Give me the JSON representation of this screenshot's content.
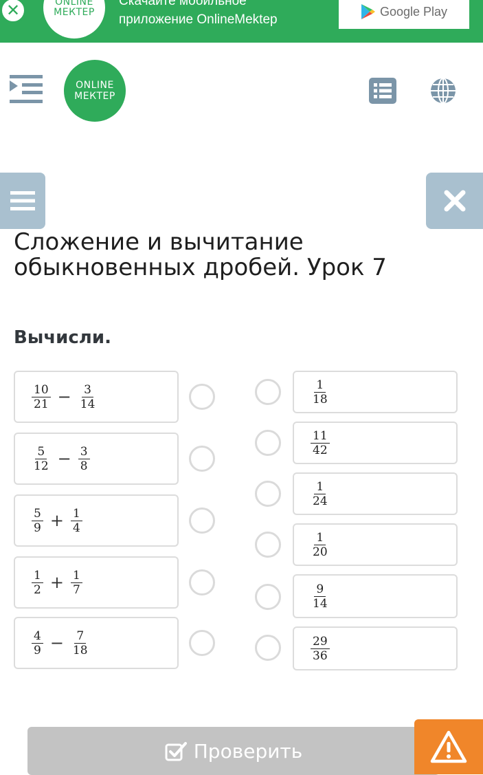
{
  "banner": {
    "logo_line1": "ONLINE",
    "logo_line2": "МЕКТЕР",
    "text_line1": "Скачайте мобильное",
    "text_line2": "приложение OnlineMektep",
    "store_label": "Google Play",
    "close_icon": "close-icon"
  },
  "header": {
    "logo_line1": "ONLINE",
    "logo_line2": "МЕКТЕР",
    "menu_icon": "menu-indent-icon",
    "list_icon": "list-icon",
    "globe_icon": "globe-icon"
  },
  "lesson": {
    "title": "Сложение и вычитание обыкновенных дробей. Урок 7",
    "task": "Вычисли."
  },
  "left_items": [
    {
      "a": {
        "n": "10",
        "d": "21"
      },
      "op": "−",
      "b": {
        "n": "3",
        "d": "14"
      }
    },
    {
      "a": {
        "n": "5",
        "d": "12"
      },
      "op": "−",
      "b": {
        "n": "3",
        "d": "8"
      }
    },
    {
      "a": {
        "n": "5",
        "d": "9"
      },
      "op": "+",
      "b": {
        "n": "1",
        "d": "4"
      }
    },
    {
      "a": {
        "n": "1",
        "d": "2"
      },
      "op": "+",
      "b": {
        "n": "1",
        "d": "7"
      }
    },
    {
      "a": {
        "n": "4",
        "d": "9"
      },
      "op": "−",
      "b": {
        "n": "7",
        "d": "18"
      }
    }
  ],
  "right_items": [
    {
      "n": "1",
      "d": "18"
    },
    {
      "n": "11",
      "d": "42"
    },
    {
      "n": "1",
      "d": "24"
    },
    {
      "n": "1",
      "d": "20"
    },
    {
      "n": "9",
      "d": "14"
    },
    {
      "n": "29",
      "d": "36"
    }
  ],
  "footer": {
    "check_label": "Проверить",
    "check_icon": "checkbox-icon",
    "warn_icon": "warning-icon"
  },
  "colors": {
    "brand_green": "#2fab5a",
    "side_button": "#a9c0cf",
    "check_button": "#c3c3c3",
    "warning": "#f0862a"
  }
}
